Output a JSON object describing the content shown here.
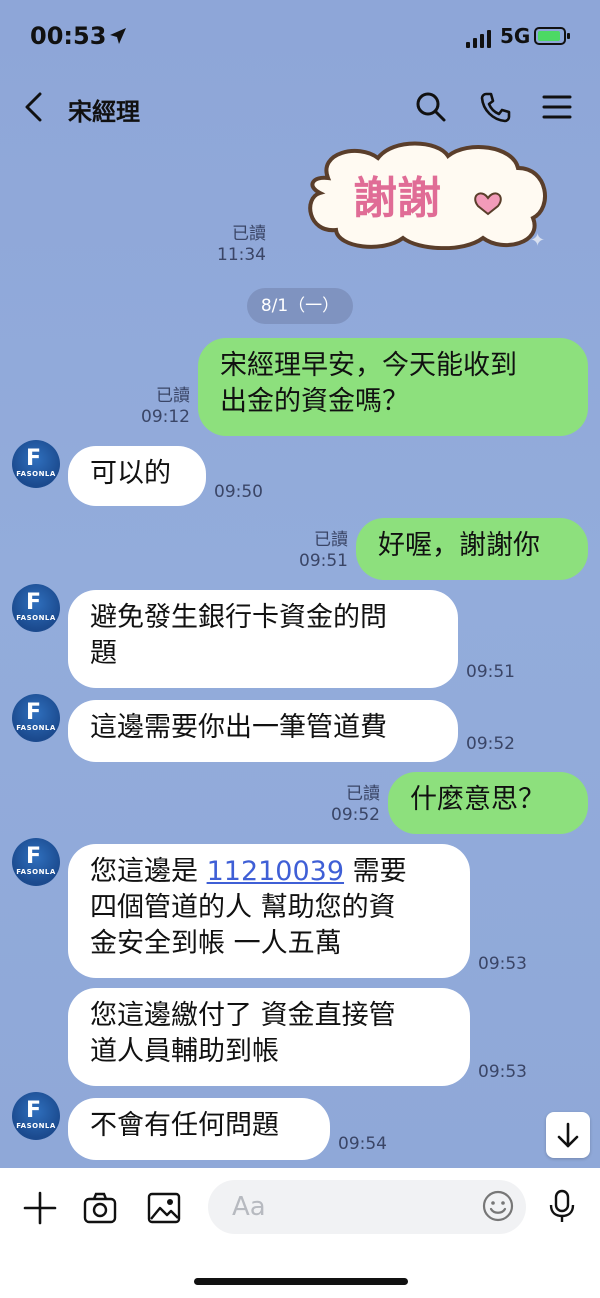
{
  "status": {
    "time": "00:53",
    "network": "5G"
  },
  "header": {
    "title": "宋經理"
  },
  "sticker": {
    "text": "謝謝"
  },
  "date_divider": "8/1（一）",
  "messages": [
    {
      "dir": "out",
      "text": "",
      "read": "已讀",
      "time": "11:34"
    },
    {
      "dir": "out",
      "text": "宋經理早安，今天能收到出金的資金嗎？",
      "line1": "宋經理早安，今天能收到",
      "line2": "出金的資金嗎？",
      "read": "已讀",
      "time": "09:12"
    },
    {
      "dir": "in",
      "text": "可以的",
      "time": "09:50"
    },
    {
      "dir": "out",
      "text": "好喔，謝謝你",
      "read": "已讀",
      "time": "09:51"
    },
    {
      "dir": "in",
      "line1": "避免發生銀行卡資金的問",
      "line2": "題",
      "time": "09:51"
    },
    {
      "dir": "in",
      "text": "這邊需要你出一筆管道費",
      "time": "09:52"
    },
    {
      "dir": "out",
      "text": "什麼意思？",
      "read": "已讀",
      "time": "09:52"
    },
    {
      "dir": "in",
      "line1_pre": "您這邊是 ",
      "line1_link": "11210039",
      "line1_post": " 需要",
      "line2": "四個管道的人 幫助您的資",
      "line3": "金安全到帳 一人五萬",
      "time": "09:53"
    },
    {
      "dir": "in",
      "line1": "您這邊繳付了 資金直接管",
      "line2": "道人員輔助到帳",
      "time": "09:53"
    },
    {
      "dir": "in",
      "text": "不會有任何問題",
      "time": "09:54"
    }
  ],
  "avatar_brand": "FASONLA",
  "input": {
    "placeholder": "Aa"
  },
  "colors": {
    "chat_bg": "#8fa8d8",
    "out_bubble": "#8de07d",
    "in_bubble": "#ffffff",
    "link": "#3f5fd6"
  }
}
